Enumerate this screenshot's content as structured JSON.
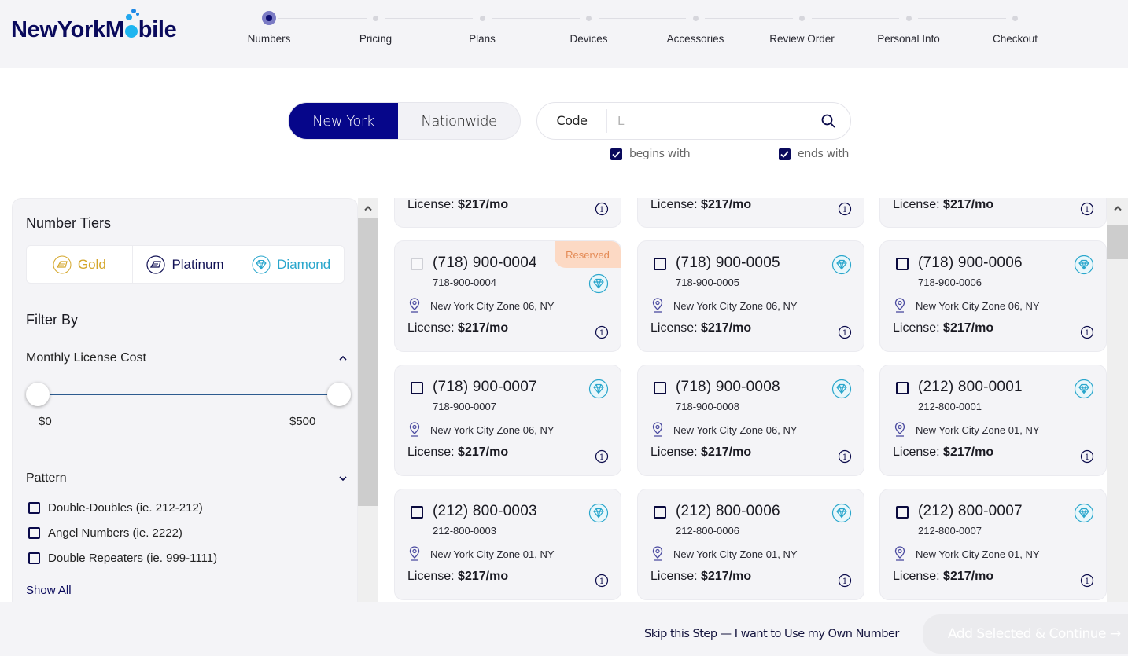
{
  "brand": {
    "name_before": "NewYorkM",
    "name_after": "bile"
  },
  "stepper": {
    "current": 0,
    "steps": [
      "Numbers",
      "Pricing",
      "Plans",
      "Devices",
      "Accessories",
      "Review Order",
      "Personal Info",
      "Checkout"
    ]
  },
  "search": {
    "region_options": [
      "New York",
      "Nationwide"
    ],
    "selected_region": "New York",
    "code_label": "Code",
    "value": "",
    "placeholder": "L",
    "begins_with": {
      "label": "begins with",
      "checked": true
    },
    "ends_with": {
      "label": "ends with",
      "checked": true
    }
  },
  "sidebar": {
    "tiers_title": "Number Tiers",
    "tiers": [
      {
        "label": "Gold",
        "icon": "gold-bar-icon",
        "color": "#d4a629"
      },
      {
        "label": "Platinum",
        "icon": "platinum-bar-icon",
        "color": "#121255"
      },
      {
        "label": "Diamond",
        "icon": "diamond-icon",
        "color": "#29a6cc"
      }
    ],
    "filter_title": "Filter By",
    "cost_filter": {
      "label": "Monthly License Cost",
      "expanded": true,
      "min_label": "$0",
      "max_label": "$500",
      "range": [
        0,
        500
      ],
      "selected": [
        0,
        500
      ]
    },
    "pattern_filter": {
      "label": "Pattern",
      "expanded": false,
      "options": [
        {
          "label": "Double-Doubles (ie. 212-212)",
          "checked": false
        },
        {
          "label": "Angel Numbers (ie. 2222)",
          "checked": false
        },
        {
          "label": "Double Repeaters (ie. 999-1111)",
          "checked": false
        }
      ],
      "show_all": "Show All"
    }
  },
  "results": {
    "partial_row": [
      {
        "license_label": "License:",
        "license_price": "$217/mo"
      },
      {
        "license_label": "License:",
        "license_price": "$217/mo"
      },
      {
        "license_label": "License:",
        "license_price": "$217/mo"
      }
    ],
    "cards": [
      {
        "number": "(718) 900-0004",
        "dashed": "718-900-0004",
        "location": "New York City Zone 06, NY",
        "license_label": "License:",
        "license_price": "$217/mo",
        "tier": "diamond",
        "reserved": true,
        "badge": "Reserved"
      },
      {
        "number": "(718) 900-0005",
        "dashed": "718-900-0005",
        "location": "New York City Zone 06, NY",
        "license_label": "License:",
        "license_price": "$217/mo",
        "tier": "diamond",
        "reserved": false
      },
      {
        "number": "(718) 900-0006",
        "dashed": "718-900-0006",
        "location": "New York City Zone 06, NY",
        "license_label": "License:",
        "license_price": "$217/mo",
        "tier": "diamond",
        "reserved": false
      },
      {
        "number": "(718) 900-0007",
        "dashed": "718-900-0007",
        "location": "New York City Zone 06, NY",
        "license_label": "License:",
        "license_price": "$217/mo",
        "tier": "diamond",
        "reserved": false
      },
      {
        "number": "(718) 900-0008",
        "dashed": "718-900-0008",
        "location": "New York City Zone 06, NY",
        "license_label": "License:",
        "license_price": "$217/mo",
        "tier": "diamond",
        "reserved": false
      },
      {
        "number": "(212) 800-0001",
        "dashed": "212-800-0001",
        "location": "New York City Zone 01, NY",
        "license_label": "License:",
        "license_price": "$217/mo",
        "tier": "diamond",
        "reserved": false
      },
      {
        "number": "(212) 800-0003",
        "dashed": "212-800-0003",
        "location": "New York City Zone 01, NY",
        "license_label": "License:",
        "license_price": "$217/mo",
        "tier": "diamond",
        "reserved": false
      },
      {
        "number": "(212) 800-0006",
        "dashed": "212-800-0006",
        "location": "New York City Zone 01, NY",
        "license_label": "License:",
        "license_price": "$217/mo",
        "tier": "diamond",
        "reserved": false
      },
      {
        "number": "(212) 800-0007",
        "dashed": "212-800-0007",
        "location": "New York City Zone 01, NY",
        "license_label": "License:",
        "license_price": "$217/mo",
        "tier": "diamond",
        "reserved": false
      }
    ]
  },
  "footer": {
    "skip_label": "Skip this Step — I want to Use my Own Number",
    "continue_label": "Add Selected & Continue →",
    "continue_enabled": false
  },
  "colors": {
    "brand_navy": "#06068a",
    "diamond": "#29a6cc",
    "reserved_bg": "#fcd9c4",
    "reserved_text": "#e48a55"
  }
}
